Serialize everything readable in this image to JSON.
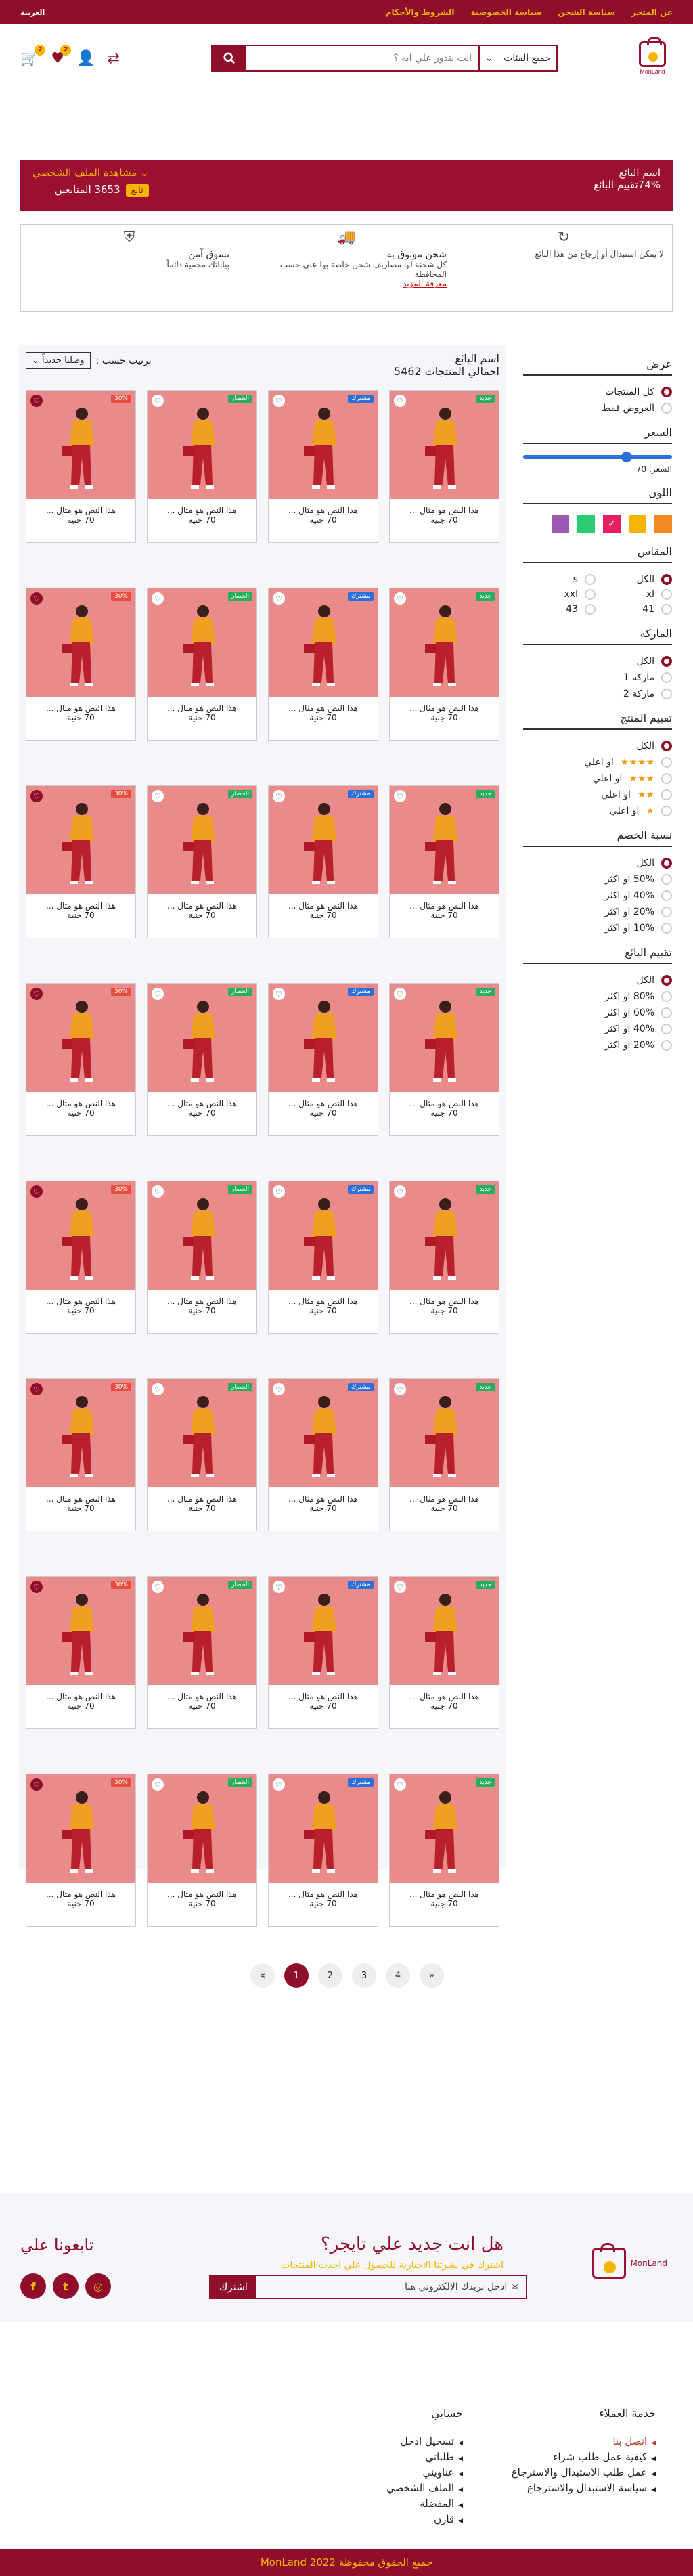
{
  "topbar": {
    "links": [
      "عن المتجر",
      "سياسة الشحن",
      "سياسة الخصوصية",
      "الشروط والأحكام"
    ],
    "lang": "العربية"
  },
  "header": {
    "logo_text": "MonLand",
    "search_category": "جميع الفئات",
    "search_placeholder": "انت بتدور علي ايه ؟",
    "cart_count": "2",
    "wish_count": "2"
  },
  "seller": {
    "name": "اسم البائع",
    "rating": "74%تقييم البائع",
    "profile": "مشاهدة الملف الشخصي",
    "followers": "3653 المتابعين",
    "follow_btn": "تابع"
  },
  "features": [
    {
      "icon": "return-icon",
      "title": "",
      "desc": "لا يمكن استبدال أو إرجاع من هذا البائع",
      "link": ""
    },
    {
      "icon": "truck-icon",
      "title": "شحن موثوق به",
      "desc": "كل شحنة لها مصاريف شحن خاصة بها علي حسب المحافظة",
      "link": "معرفة المزيد"
    },
    {
      "icon": "shield-icon",
      "title": "تسوق آمن",
      "desc": "بياناتك محمية دائماً",
      "link": ""
    }
  ],
  "sidebar": {
    "view_title": "عرض",
    "view_opts": [
      "كل المنتجات",
      "العروض فقط"
    ],
    "price_title": "السعر",
    "price_value": "السعر: 70",
    "color_title": "اللون",
    "colors": [
      "#f08a24",
      "#f5b400",
      "#e91e63",
      "#2ecc71",
      "#9b59b6"
    ],
    "size_title": "المقاس",
    "sizes": [
      "الكل",
      "s",
      "xl",
      "xxl",
      "41",
      "43"
    ],
    "brand_title": "الماركة",
    "brands": [
      "الكل",
      "ماركة 1",
      "ماركة 2"
    ],
    "rating_title": "تقييم المنتج",
    "rating_all": "الكل",
    "rating_suffix": "او اعلي",
    "discount_title": "نسبة الخصم",
    "discounts": [
      "الكل",
      "50% او اكثر",
      "40% او اكثر",
      "20% او اكثر",
      "10% او اكثر"
    ],
    "seller_title": "تقييم البائع",
    "seller_opts": [
      "الكل",
      "80% او اكثر",
      "60% او اكثر",
      "40% او اكثر",
      "20% او اكثر"
    ]
  },
  "content": {
    "seller_name": "اسم البائع",
    "total": "اجمالي المنتجات 5462",
    "sort_label": "ترتيب حسب :",
    "sort_value": "وصلنا جديداً"
  },
  "product": {
    "text": "هذا النص هو مثال ...",
    "price": "70 جنية"
  },
  "tags": [
    {
      "label": "جديد",
      "color": "#27ae60"
    },
    {
      "label": "مشترك",
      "color": "#2a6fdb"
    },
    {
      "label": "الحصار",
      "color": "#27ae60"
    },
    {
      "label": "30%",
      "color": "#e74c3c"
    }
  ],
  "pager": [
    "«",
    "1",
    "2",
    "3",
    "4",
    "»"
  ],
  "newsletter": {
    "logo_text": "MonLand",
    "title": "هل انت جديد علي تايجر؟",
    "sub": "اشترك في نشرتنا الاخبارية للحصول علي احدث المنتجات",
    "placeholder": "ادخل بريدك الالكتروني هنا",
    "btn": "اشترك",
    "follow": "تابعونا علي"
  },
  "footer": {
    "service_title": "خدمة العملاء",
    "service": [
      "اتصل بنا",
      "كيفية عمل طلب شراء",
      "عمل طلب الاستبدال والاسترجاع",
      "سياسة الاستبدال والاسترجاع"
    ],
    "account_title": "حسابي",
    "account": [
      "تسجيل ادخل",
      "طلباتي",
      "عناويني",
      "الملف الشخصي",
      "المفضلة",
      "قارن"
    ],
    "copyright": "جميع الحقوق محفوظة  MonLand 2022"
  }
}
